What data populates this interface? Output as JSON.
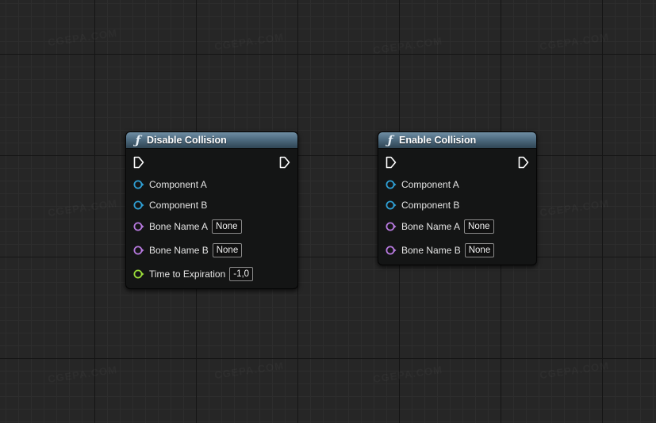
{
  "colors": {
    "header_accent": "#4e6b80",
    "object_pin": "#2f9fd4",
    "name_pin": "#b87ae0",
    "float_pin": "#9bdc3a",
    "exec_pin": "#ffffff"
  },
  "nodes": [
    {
      "title": "Disable Collision",
      "icon": "function-icon",
      "pins": [
        {
          "label": "Component A",
          "type": "object"
        },
        {
          "label": "Component B",
          "type": "object"
        },
        {
          "label": "Bone Name A",
          "type": "name",
          "value": "None"
        },
        {
          "label": "Bone Name B",
          "type": "name",
          "value": "None"
        },
        {
          "label": "Time to Expiration",
          "type": "float",
          "value": "-1,0"
        }
      ]
    },
    {
      "title": "Enable Collision",
      "icon": "function-icon",
      "pins": [
        {
          "label": "Component A",
          "type": "object"
        },
        {
          "label": "Component B",
          "type": "object"
        },
        {
          "label": "Bone Name A",
          "type": "name",
          "value": "None"
        },
        {
          "label": "Bone Name B",
          "type": "name",
          "value": "None"
        }
      ]
    }
  ]
}
